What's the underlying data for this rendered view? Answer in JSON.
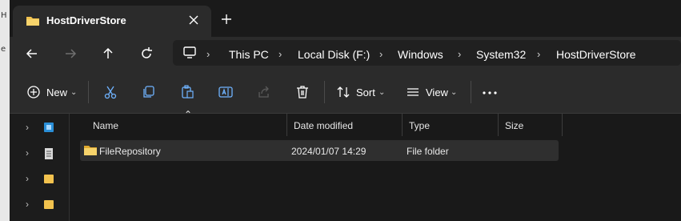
{
  "window": {
    "tab_title": "HostDriverStore"
  },
  "address_bar": {
    "crumbs": [
      "This PC",
      "Local Disk (F:)",
      "Windows",
      "System32",
      "HostDriverStore"
    ]
  },
  "toolbar": {
    "new_label": "New",
    "sort_label": "Sort",
    "view_label": "View"
  },
  "columns": {
    "name": "Name",
    "date_modified": "Date modified",
    "type": "Type",
    "size": "Size"
  },
  "files": [
    {
      "name": "FileRepository",
      "date_modified": "2024/01/07 14:29",
      "type": "File folder",
      "size": ""
    }
  ],
  "desktop_strip": {
    "glyphs": [
      "H",
      "e"
    ]
  },
  "colors": {
    "folder": "#f2c24e",
    "background": "#202020",
    "accent": "#0f6cbd"
  }
}
